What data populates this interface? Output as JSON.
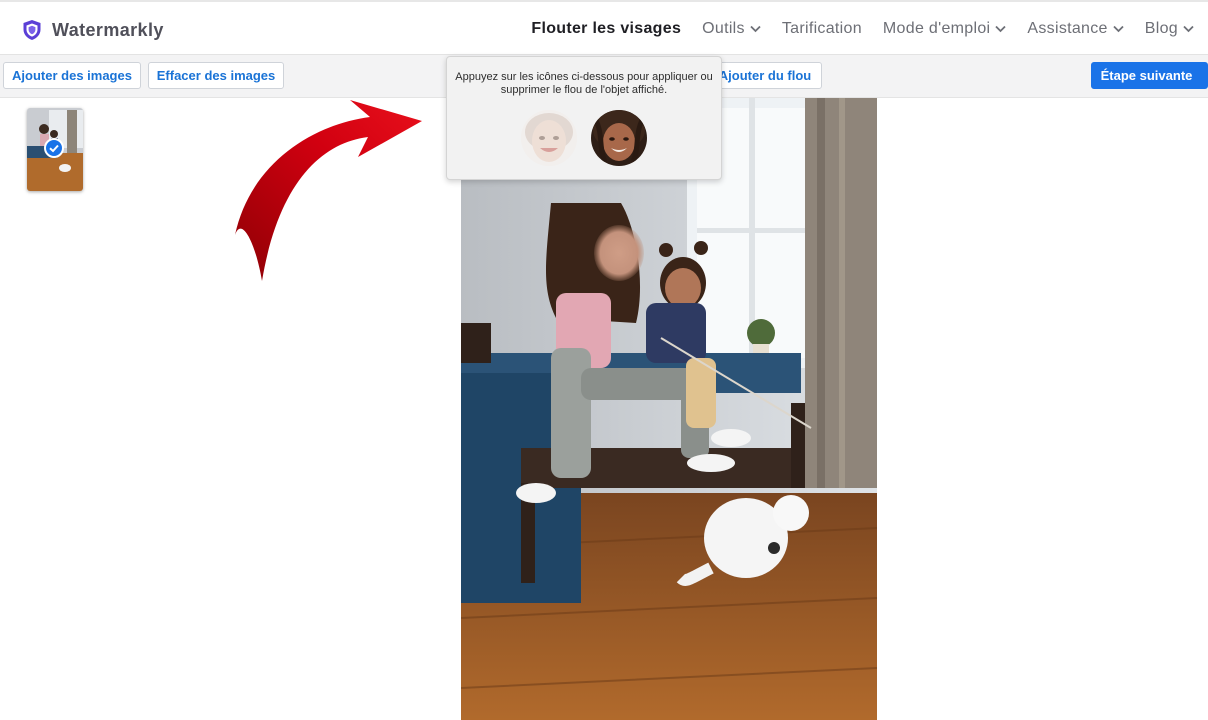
{
  "app": {
    "name": "Watermarkly"
  },
  "nav": {
    "items": [
      {
        "label": "Flouter les visages",
        "active": true,
        "dropdown": false
      },
      {
        "label": "Outils",
        "active": false,
        "dropdown": true
      },
      {
        "label": "Tarification",
        "active": false,
        "dropdown": false
      },
      {
        "label": "Mode d'emploi",
        "active": false,
        "dropdown": true
      },
      {
        "label": "Assistance",
        "active": false,
        "dropdown": true
      },
      {
        "label": "Blog",
        "active": false,
        "dropdown": true
      }
    ]
  },
  "toolbar": {
    "add_images_label": "Ajouter des images",
    "clear_images_label": "Effacer des images",
    "add_blur_label": "Ajouter du flou",
    "next_step_label": "Étape suivante"
  },
  "popup": {
    "instruction": "Appuyez sur les icônes ci-dessous pour appliquer ou supprimer le flou de l'objet affiché.",
    "faces": [
      {
        "name": "face-thumbnail-blurred",
        "state": "blurred"
      },
      {
        "name": "face-thumbnail-sharp",
        "state": "not-blurred"
      }
    ]
  },
  "colors": {
    "accent": "#1a73e8",
    "arrow": "#d0000a",
    "logo": "#5b3fd6"
  },
  "icons": {
    "logo": "shield-icon",
    "dropdown": "chevron-down-icon",
    "next": "chevron-right-icon",
    "selected": "check-icon"
  }
}
